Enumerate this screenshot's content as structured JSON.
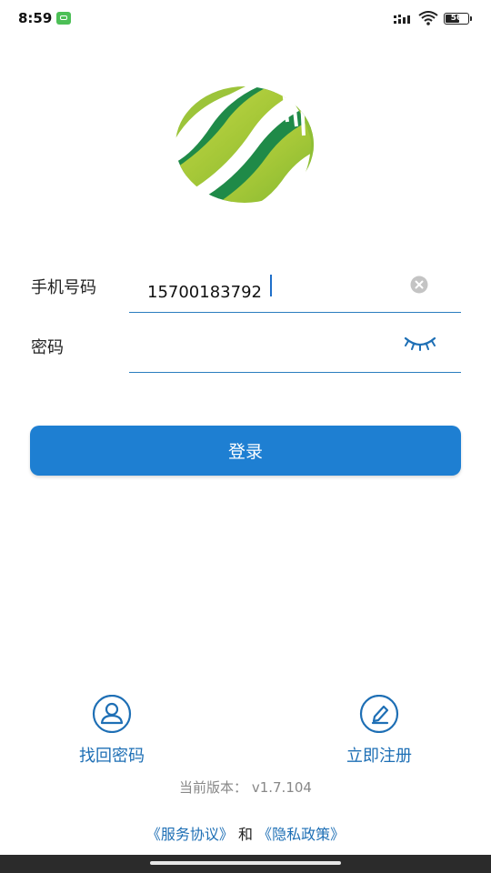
{
  "status_bar": {
    "time": "8:59",
    "battery_text": "56",
    "battery_level": 0.56,
    "icons": [
      "app-notification-icon",
      "signal-icon",
      "wifi-icon",
      "battery-icon"
    ]
  },
  "logo": {
    "icon": "green-globe-logo"
  },
  "form": {
    "phone_label": "手机号码",
    "phone_value": "15700183792",
    "password_label": "密码",
    "password_value": "",
    "clear_icon": "clear-circle-icon",
    "eye_icon": "eye-closed-icon"
  },
  "login_button": {
    "label": "登录"
  },
  "bottom": {
    "recover_label": "找回密码",
    "recover_icon": "user-icon",
    "register_label": "立即注册",
    "register_icon": "pencil-icon",
    "version_text": "当前版本：  v1.7.104",
    "service_agreement": "《服务协议》",
    "conjunction": "和",
    "privacy_policy": "《隐私政策》"
  },
  "colors": {
    "accent": "#1e7fd2",
    "link": "#1e6fb5",
    "logo_light_green": "#a6c838",
    "logo_dark_green": "#1f8a48"
  }
}
